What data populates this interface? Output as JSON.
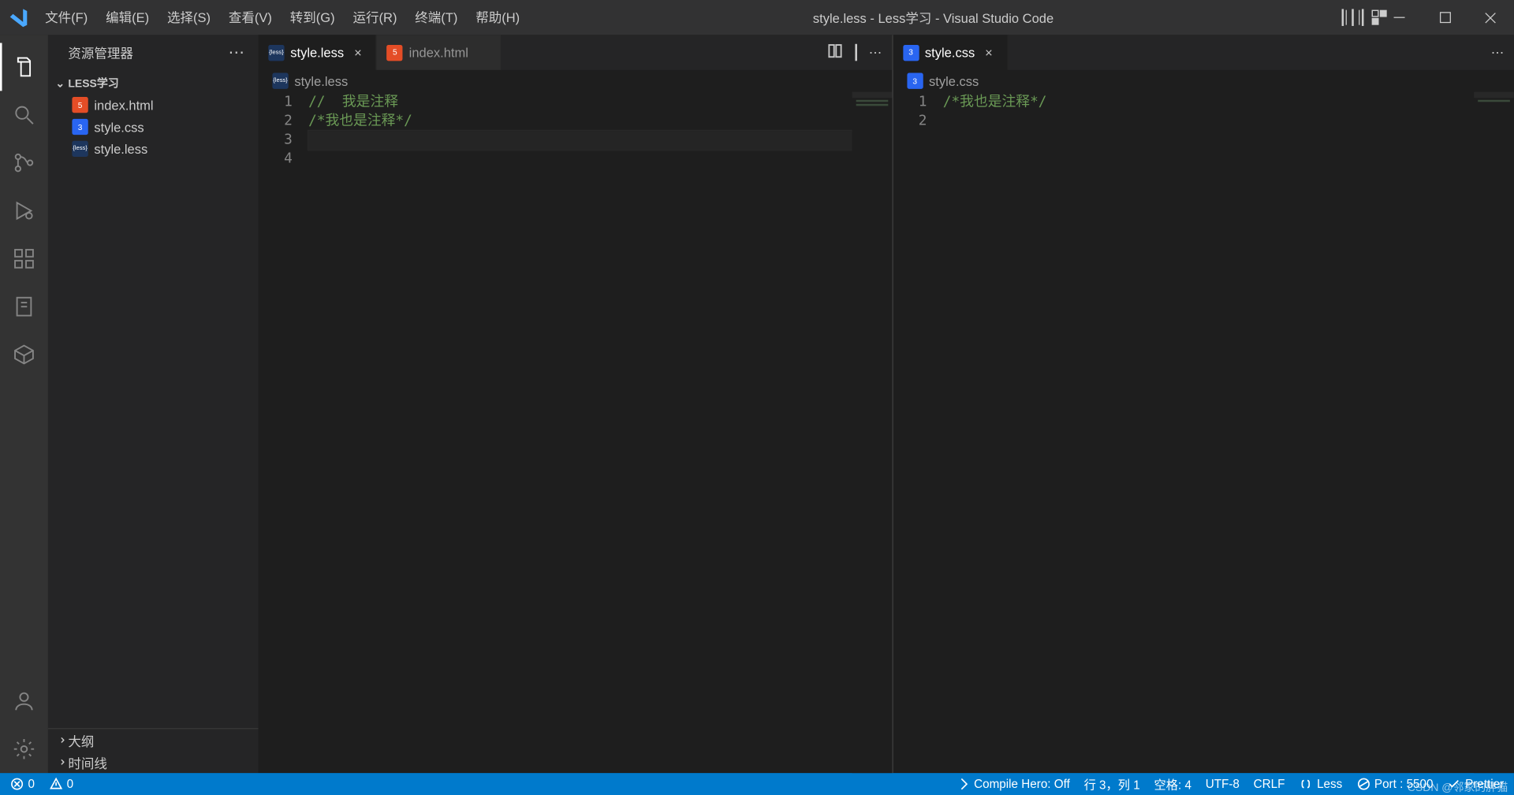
{
  "window": {
    "title": "style.less - Less学习 - Visual Studio Code"
  },
  "menubar": [
    "文件(F)",
    "编辑(E)",
    "选择(S)",
    "查看(V)",
    "转到(G)",
    "运行(R)",
    "终端(T)",
    "帮助(H)"
  ],
  "sidebar": {
    "header": "资源管理器",
    "project": "LESS学习",
    "files": [
      {
        "name": "index.html",
        "icon": "html"
      },
      {
        "name": "style.css",
        "icon": "css"
      },
      {
        "name": "style.less",
        "icon": "less"
      }
    ],
    "sections": [
      "大纲",
      "时间线"
    ]
  },
  "activity": [
    "explorer",
    "search",
    "source-control",
    "run",
    "extensions",
    "notes",
    "package",
    "account",
    "settings"
  ],
  "editorLeft": {
    "tabs": [
      {
        "name": "style.less",
        "icon": "less",
        "active": true,
        "closable": true
      },
      {
        "name": "index.html",
        "icon": "html",
        "active": false,
        "closable": false
      }
    ],
    "breadcrumb": "style.less",
    "breadcrumbIcon": "less",
    "lineNumbers": [
      "1",
      "2",
      "3",
      "4"
    ],
    "code": [
      {
        "text": "//  我是注释",
        "cls": "comment-green",
        "current": false
      },
      {
        "text": "/*我也是注释*/",
        "cls": "comment-green",
        "current": false
      },
      {
        "text": "",
        "cls": "",
        "current": true
      },
      {
        "text": "",
        "cls": "",
        "current": false
      }
    ]
  },
  "editorRight": {
    "tabs": [
      {
        "name": "style.css",
        "icon": "css",
        "active": true,
        "closable": true
      }
    ],
    "breadcrumb": "style.css",
    "breadcrumbIcon": "css",
    "lineNumbers": [
      "1",
      "2"
    ],
    "code": [
      {
        "text": "/*我也是注释*/",
        "cls": "comment-green",
        "current": false
      },
      {
        "text": "",
        "cls": "",
        "current": false
      }
    ]
  },
  "statusbar": {
    "errors": "0",
    "warnings": "0",
    "compileHero": "Compile Hero: Off",
    "cursor": "行 3，列 1",
    "spaces": "空格: 4",
    "encoding": "UTF-8",
    "eol": "CRLF",
    "language": "Less",
    "port": "Port : 5500",
    "prettier": "Prettier"
  },
  "watermark": "CSDN @邻家的胖猫"
}
